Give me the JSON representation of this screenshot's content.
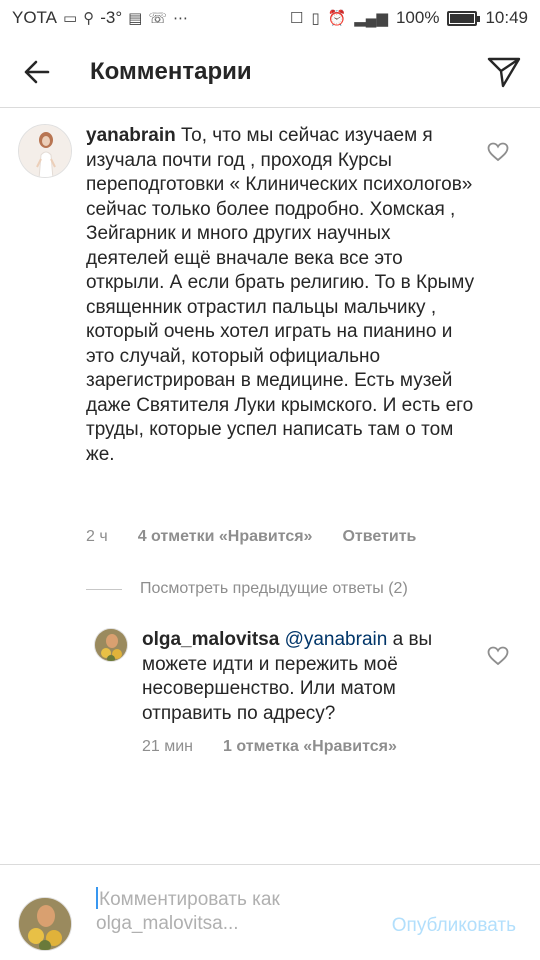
{
  "status_bar": {
    "carrier": "YOTA",
    "temperature": "-3°",
    "battery": "100%",
    "battery_level": 1.0,
    "time": "10:49",
    "network": "4G"
  },
  "header": {
    "title": "Комментарии"
  },
  "comment": {
    "username": "yanabrain",
    "text": "То, что мы сейчас изучаем я изучала почти год , проходя Курсы переподготовки « Клинических психологов» сейчас только более подробно. Хомская , Зейгарник и много других научных деятелей ещё вначале века все это открыли. А если брать религию. То в Крыму священник отрастил пальцы мальчику , который очень хотел играть на пианино и это случай, который официально зарегистрирован в медицине. Есть музей даже Святителя Луки крымского. И есть его труды, которые успел написать там о том же.",
    "time": "2 ч",
    "likes": "4 отметки «Нравится»",
    "reply_label": "Ответить"
  },
  "view_replies": "Посмотреть предыдущие ответы (2)",
  "reply": {
    "username": "olga_malovitsa",
    "mention": "@yanabrain",
    "text": "а вы можете  идти и пережить моё несовершенство. Или матом отправить по адресу?",
    "time": "21 мин",
    "likes": "1 отметка «Нравится»"
  },
  "composer": {
    "placeholder": "Комментировать как olga_malovitsa...",
    "publish_label": "Опубликовать"
  },
  "colors": {
    "text": "#262626",
    "meta": "#8e8e8e",
    "mention": "#003569",
    "publish_disabled": "#b2dffc",
    "divider": "#dbdbdb"
  }
}
